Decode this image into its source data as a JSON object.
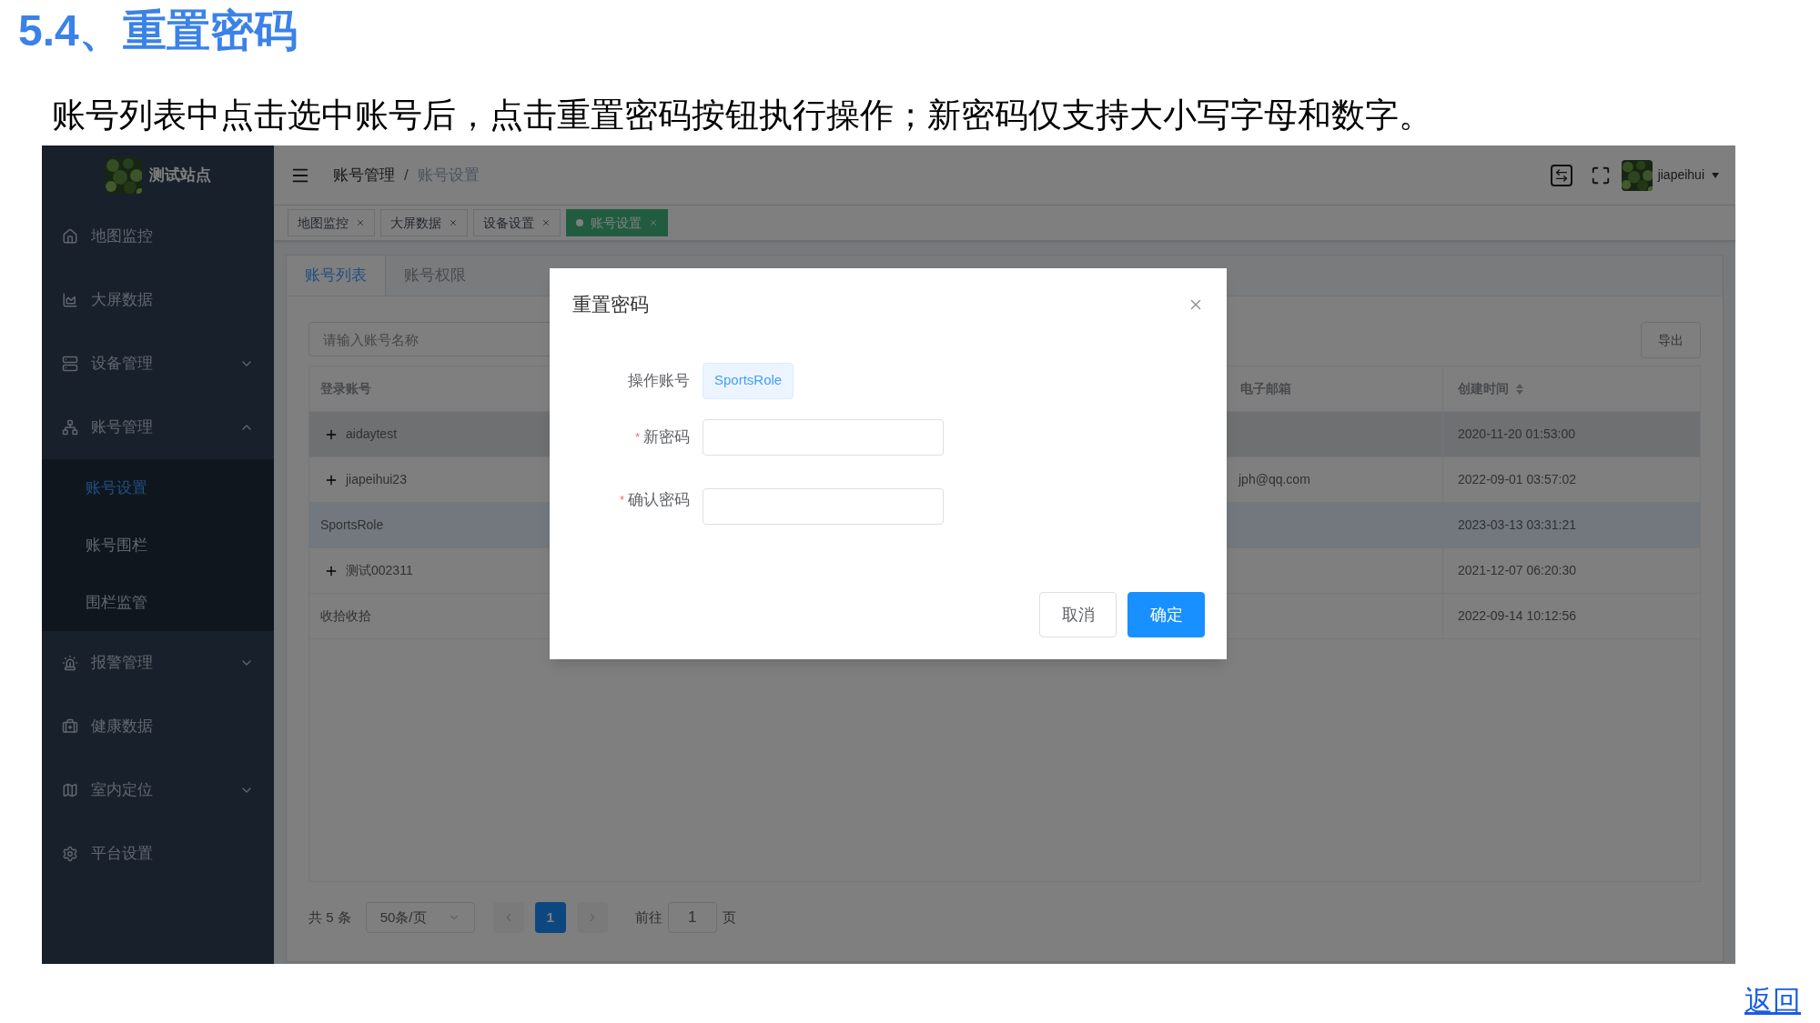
{
  "heading": "5.4、重置密码",
  "intro": "账号列表中点击选中账号后，点击重置密码按钮执行操作；新密码仅支持大小写字母和数字。",
  "app": {
    "site_name": "测试站点",
    "sidebar": {
      "items": [
        {
          "label": "地图监控"
        },
        {
          "label": "大屏数据"
        },
        {
          "label": "设备管理",
          "expanded": false
        },
        {
          "label": "账号管理",
          "expanded": true,
          "children": [
            {
              "label": "账号设置",
              "selected": true
            },
            {
              "label": "账号围栏",
              "selected": false
            },
            {
              "label": "围栏监管",
              "selected": false
            }
          ]
        },
        {
          "label": "报警管理",
          "expanded": false
        },
        {
          "label": "健康数据"
        },
        {
          "label": "室内定位",
          "expanded": false
        },
        {
          "label": "平台设置"
        }
      ]
    },
    "breadcrumb": [
      "账号管理",
      "账号设置"
    ],
    "breadcrumb_separator": "/",
    "user": "jiapeihui",
    "tags": [
      {
        "label": "地图监控",
        "selected": false
      },
      {
        "label": "大屏数据",
        "selected": false
      },
      {
        "label": "设备设置",
        "selected": false
      },
      {
        "label": "账号设置",
        "selected": true
      }
    ],
    "tabs": [
      {
        "label": "账号列表",
        "selected": true
      },
      {
        "label": "账号权限",
        "selected": false
      }
    ],
    "search": {
      "placeholder": "请输入账号名称"
    },
    "export_button": "导出",
    "table": {
      "columns": [
        "登录账号",
        "电子邮箱",
        "创建时间"
      ],
      "rows": [
        {
          "expandable": true,
          "hovered": true,
          "selected": false,
          "cells": [
            "aidaytest",
            "",
            "2020-11-20 01:53:00"
          ]
        },
        {
          "expandable": true,
          "hovered": false,
          "selected": false,
          "cells": [
            "jiapeihui23",
            "jph@qq.com",
            "2022-09-01 03:57:02"
          ]
        },
        {
          "expandable": false,
          "hovered": false,
          "selected": true,
          "cells": [
            "SportsRole",
            "",
            "2023-03-13 03:31:21"
          ]
        },
        {
          "expandable": true,
          "hovered": false,
          "selected": false,
          "cells": [
            "测试002311",
            "",
            "2021-12-07 06:20:30"
          ]
        },
        {
          "expandable": false,
          "hovered": false,
          "selected": false,
          "cells": [
            "收拾收拾",
            "",
            "2022-09-14 10:12:56"
          ]
        }
      ]
    },
    "pagination": {
      "total": "共 5 条",
      "page_size": "50条/页",
      "pages": [
        {
          "label": "1",
          "selected": true
        }
      ],
      "goto_label": "前往",
      "goto_value": "1",
      "goto_suffix": "页"
    },
    "dialog": {
      "title": "重置密码",
      "fields": [
        {
          "kind": "tag",
          "label": "操作账号",
          "value": "SportsRole"
        },
        {
          "kind": "input",
          "label": "新密码",
          "required_mark": "*"
        },
        {
          "kind": "input",
          "label": "确认密码",
          "required_mark": "*"
        }
      ],
      "buttons": [
        {
          "label": "取消",
          "primary": false
        },
        {
          "label": "确定",
          "primary": true
        }
      ]
    }
  },
  "back_link": "返回"
}
